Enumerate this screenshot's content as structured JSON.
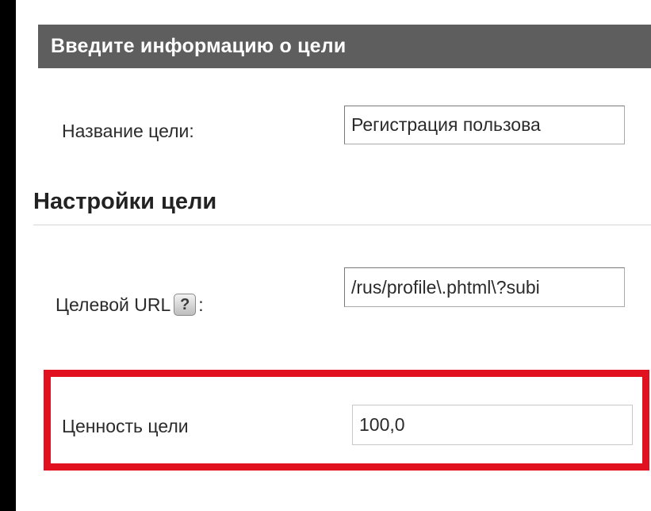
{
  "goal_info": {
    "header_title": "Введите информацию о цели",
    "name_label": "Название цели:",
    "name_value": "Регистрация пользова"
  },
  "goal_settings": {
    "heading": "Настройки цели",
    "url_label_prefix": "Целевой URL",
    "url_label_suffix": ":",
    "help_icon_glyph": "?",
    "url_value": "/rus/profile\\.phtml\\?subi",
    "value_label": "Ценность цели",
    "value_value": "100,0"
  },
  "colors": {
    "header_bg": "#5e5e5e",
    "highlight_border": "#e2111f",
    "frame_bg": "#000000"
  }
}
